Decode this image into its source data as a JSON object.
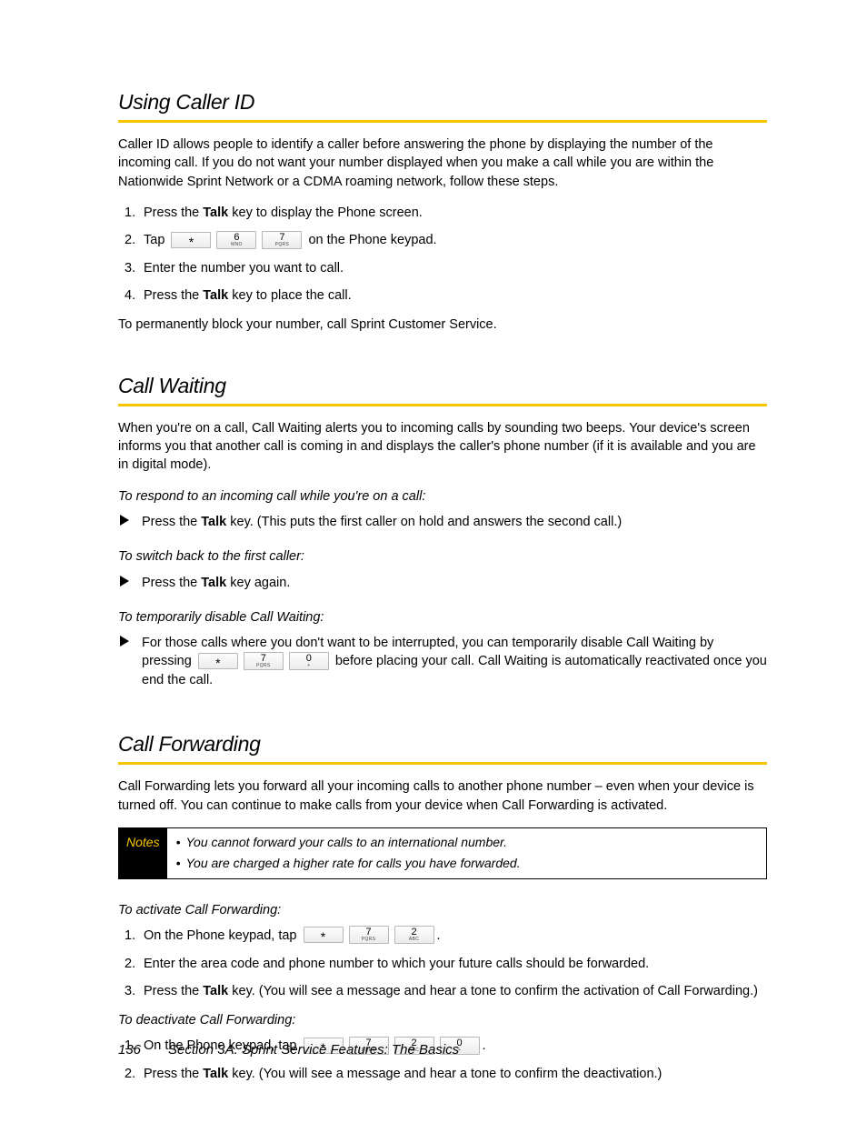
{
  "section1": {
    "heading": "Using Caller ID",
    "intro": "Caller ID allows people to identify a caller before answering the phone by displaying the number of the incoming call. If you do not want your number displayed when you make a call while you are within the Nationwide Sprint Network or a CDMA roaming network, follow these steps.",
    "steps": {
      "s1a": "Press the ",
      "s1b": "Talk",
      "s1c": " key to display the Phone screen.",
      "s2a": "Tap ",
      "s2b": " on the Phone keypad.",
      "s3": "Enter the number you want to call.",
      "s4a": "Press the ",
      "s4b": "Talk",
      "s4c": " key to place the call."
    },
    "outro": "To permanently block your number, call Sprint Customer Service."
  },
  "section2": {
    "heading": "Call Waiting",
    "intro": "When you're on a call, Call Waiting alerts you to incoming calls by sounding two beeps. Your device's screen informs you that another call is coming in and displays the caller's phone number (if it is available and you are in digital mode).",
    "sub1": "To respond to an incoming call while you're on a call:",
    "sub1_item_a": "Press the ",
    "sub1_item_b": "Talk",
    "sub1_item_c": " key. (This puts the first caller on hold and answers the second call.)",
    "sub2": "To switch back to the first caller:",
    "sub2_item_a": "Press the ",
    "sub2_item_b": "Talk",
    "sub2_item_c": " key again.",
    "sub3": "To temporarily disable Call Waiting:",
    "sub3_item_a": "For those calls where you don't want to be interrupted, you can temporarily disable Call Waiting by pressing ",
    "sub3_item_b": " before placing your call. Call Waiting is automatically reactivated once you end the call."
  },
  "section3": {
    "heading": "Call Forwarding",
    "intro": "Call Forwarding lets you forward all your incoming calls to another phone number – even when your device is turned off. You can continue to make calls from your device when Call Forwarding is activated.",
    "notes_label": "Notes",
    "notes": {
      "n1": "You cannot forward your calls to an international number.",
      "n2": "You are charged a higher rate for calls you have forwarded."
    },
    "sub1": "To activate Call Forwarding:",
    "s1_1a": "On the Phone keypad, tap ",
    "s1_1b": ".",
    "s1_2": "Enter the area code and phone number to which your future calls should be forwarded.",
    "s1_3a": "Press the ",
    "s1_3b": "Talk",
    "s1_3c": " key. (You will see a message and hear a tone to confirm the activation of Call Forwarding.)",
    "sub2": "To deactivate Call Forwarding:",
    "s2_1a": "On the Phone keypad, tap ",
    "s2_1b": ".",
    "s2_2a": "Press the ",
    "s2_2b": "Talk",
    "s2_2c": " key. (You will see a message and hear a tone to confirm the deactivation.)"
  },
  "keys": {
    "star": "*",
    "k6": "6",
    "k6sub": "MNO",
    "k7": "7",
    "k7sub": "PQRS",
    "k0": "0",
    "k0sub": "+",
    "k2": "2",
    "k2sub": "ABC"
  },
  "nums": {
    "n1": "1.",
    "n2": "2.",
    "n3": "3.",
    "n4": "4."
  },
  "footer": {
    "page": "136",
    "title": "Section 3A. Sprint Service Features: The Basics"
  }
}
